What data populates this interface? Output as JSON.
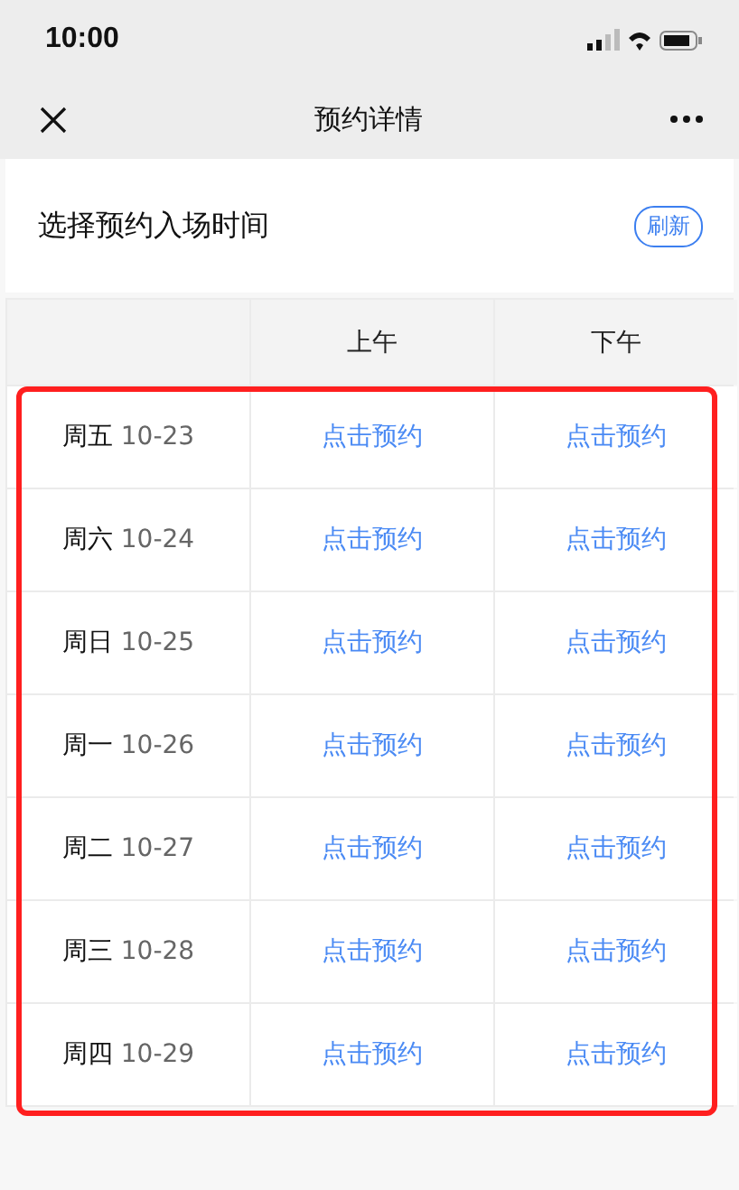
{
  "status_bar": {
    "time": "10:00"
  },
  "nav": {
    "title": "预约详情"
  },
  "section": {
    "title": "选择预约入场时间",
    "refresh_button": "刷新"
  },
  "table": {
    "columns": [
      "上午",
      "下午"
    ],
    "rows": [
      {
        "weekday": "周五",
        "date": "10-23",
        "cells": [
          "点击预约",
          "点击预约"
        ]
      },
      {
        "weekday": "周六",
        "date": "10-24",
        "cells": [
          "点击预约",
          "点击预约"
        ]
      },
      {
        "weekday": "周日",
        "date": "10-25",
        "cells": [
          "点击预约",
          "点击预约"
        ]
      },
      {
        "weekday": "周一",
        "date": "10-26",
        "cells": [
          "点击预约",
          "点击预约"
        ]
      },
      {
        "weekday": "周二",
        "date": "10-27",
        "cells": [
          "点击预约",
          "点击预约"
        ]
      },
      {
        "weekday": "周三",
        "date": "10-28",
        "cells": [
          "点击预约",
          "点击预约"
        ]
      },
      {
        "weekday": "周四",
        "date": "10-29",
        "cells": [
          "点击预约",
          "点击预约"
        ]
      }
    ]
  }
}
